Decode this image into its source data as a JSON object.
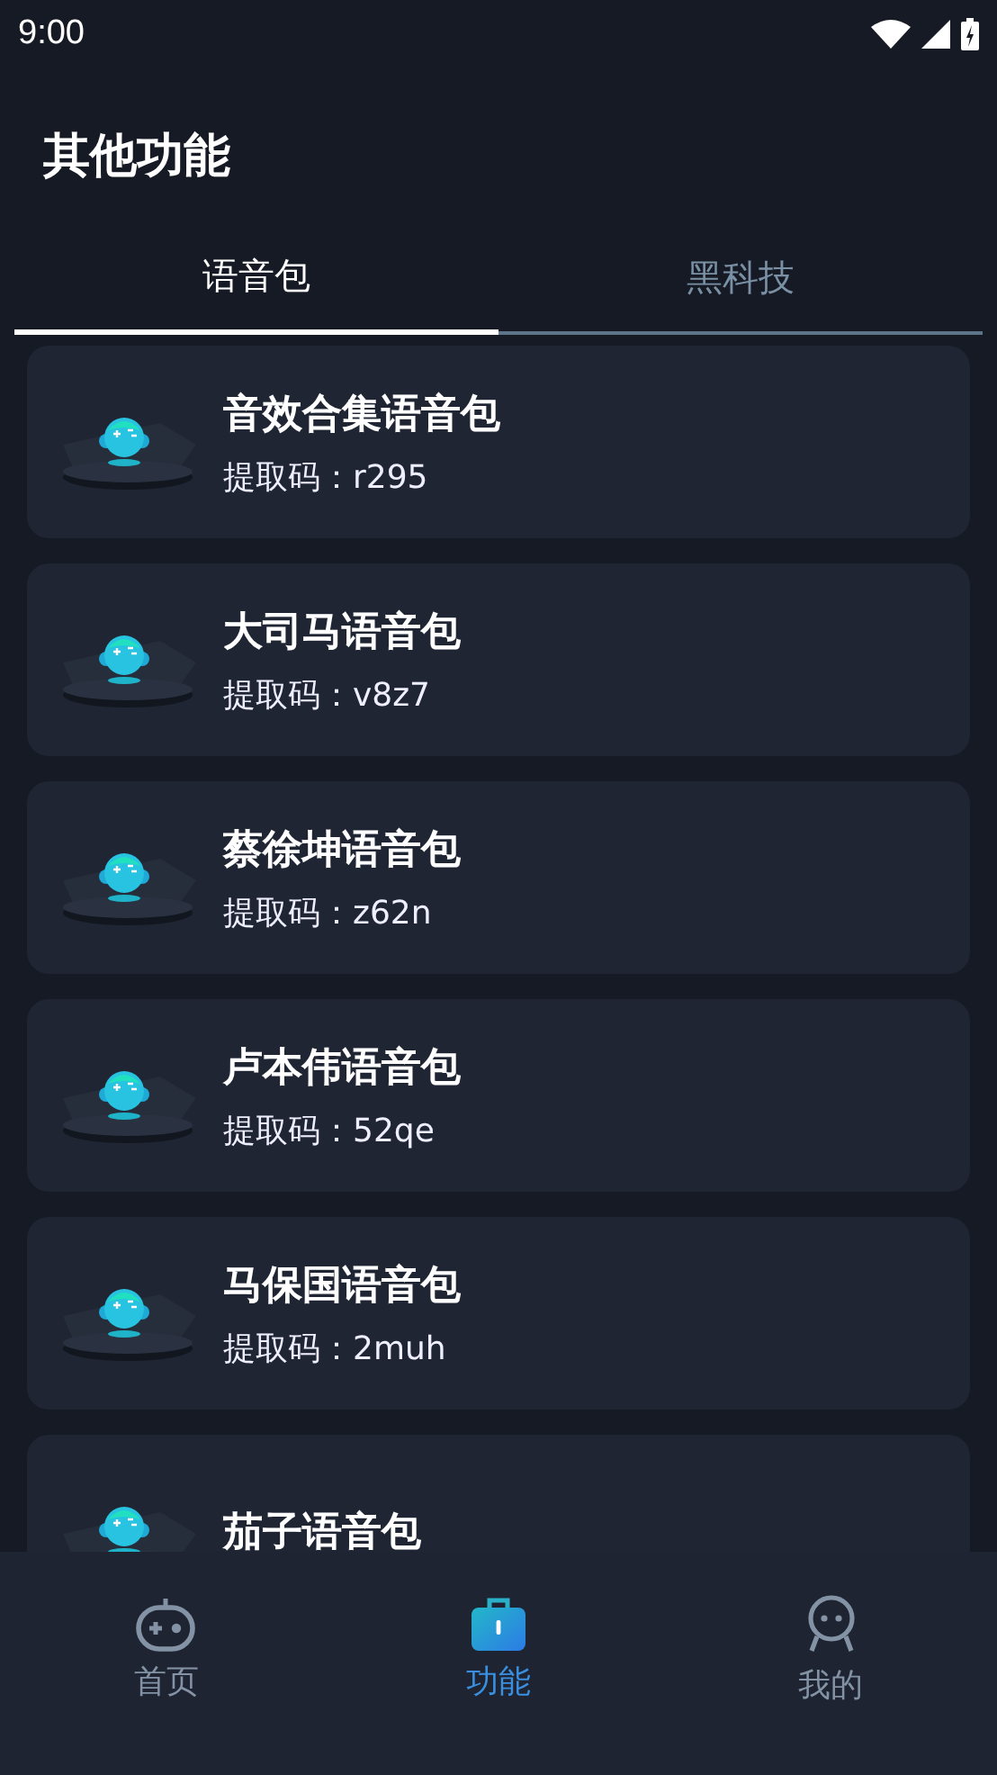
{
  "status_bar": {
    "time": "9:00"
  },
  "header": {
    "title": "其他功能"
  },
  "tabs": [
    {
      "label": "语音包",
      "selected": true
    },
    {
      "label": "黑科技",
      "selected": false
    }
  ],
  "packs": [
    {
      "name": "音效合集语音包",
      "code": "提取码：r295"
    },
    {
      "name": "大司马语音包",
      "code": "提取码：v8z7"
    },
    {
      "name": "蔡徐坤语音包",
      "code": "提取码：z62n"
    },
    {
      "name": "卢本伟语音包",
      "code": "提取码：52qe"
    },
    {
      "name": "马保国语音包",
      "code": "提取码：2muh"
    },
    {
      "name": "茄子语音包"
    }
  ],
  "bottom_nav": [
    {
      "label": "首页",
      "kind": "gamepad",
      "selected": false
    },
    {
      "label": "功能",
      "kind": "briefcase",
      "selected": true
    },
    {
      "label": "我的",
      "kind": "person",
      "selected": false
    }
  ]
}
